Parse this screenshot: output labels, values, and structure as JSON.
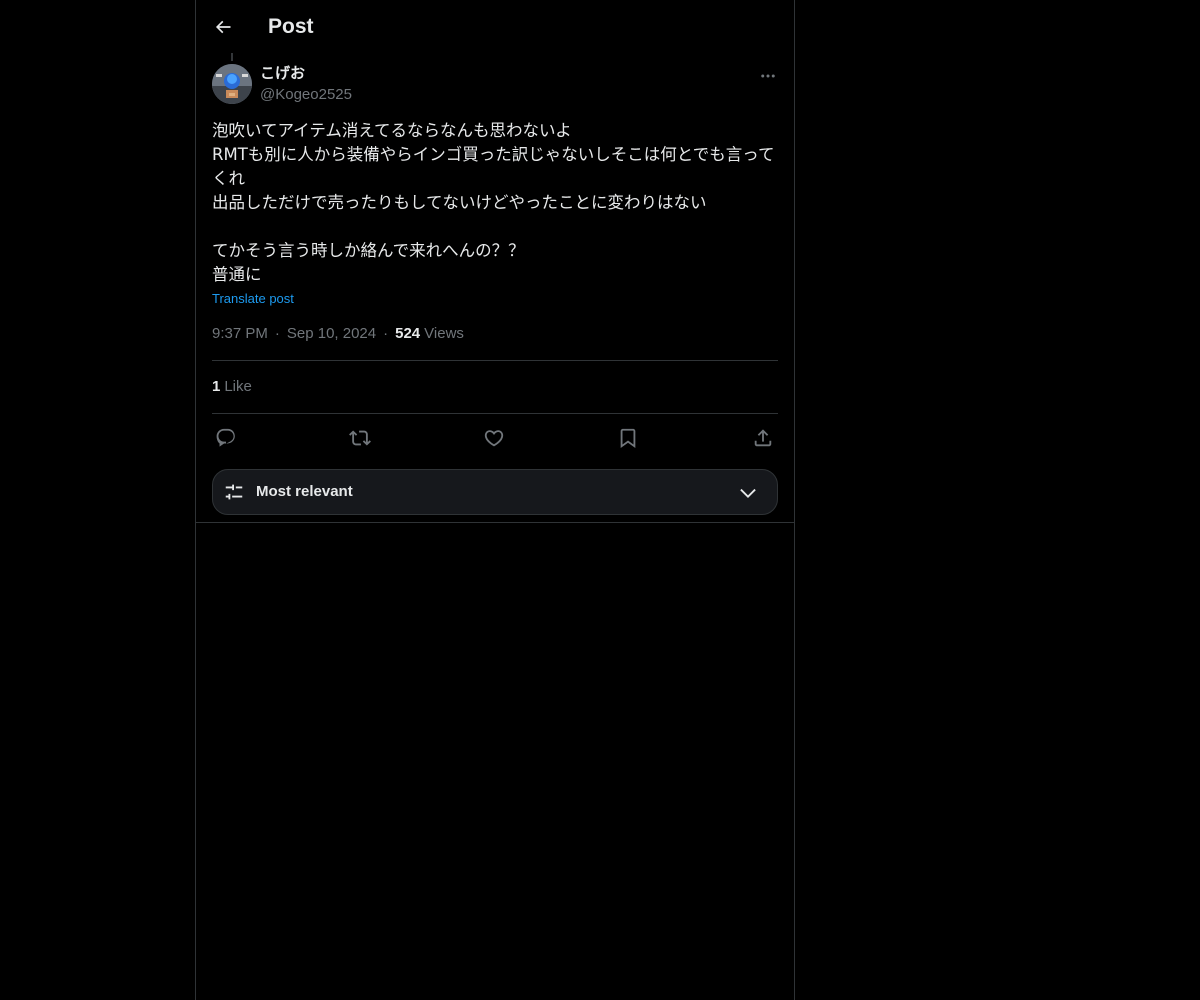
{
  "header": {
    "title": "Post"
  },
  "post": {
    "author": {
      "name": "こげお",
      "handle": "@Kogeo2525"
    },
    "text": "泡吹いてアイテム消えてるならなんも思わないよ\nRMTも別に人から装備やらインゴ買った訳じゃないしそこは何とでも言ってくれ\n出品しただけで売ったりもしてないけどやったことに変わりはない\n\nてかそう言う時しか絡んで来れへんの？？\n普通に",
    "translate_label": "Translate post",
    "time": "9:37 PM",
    "date": "Sep 10, 2024",
    "views_count": "524",
    "views_label": "Views",
    "likes_count": "1",
    "likes_label": "Like"
  },
  "actions": {
    "reply_icon": "reply-icon",
    "repost_icon": "repost-icon",
    "like_icon": "heart-icon",
    "bookmark_icon": "bookmark-icon",
    "share_icon": "share-icon"
  },
  "replies_sort": {
    "label": "Most relevant"
  },
  "colors": {
    "background": "#000000",
    "text": "#e7e9ea",
    "secondary_text": "#71767b",
    "link": "#1d9bf0",
    "border": "#2f3336"
  }
}
